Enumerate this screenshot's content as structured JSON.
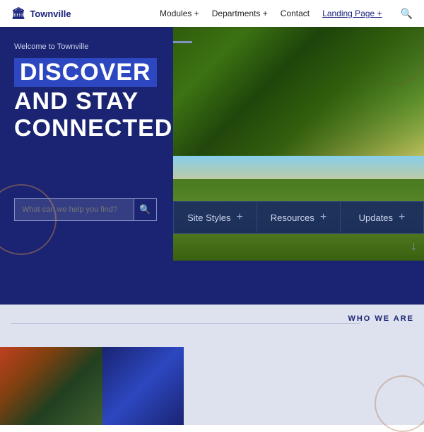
{
  "navbar": {
    "logo_text": "Townville",
    "links": [
      {
        "label": "Modules +",
        "id": "modules"
      },
      {
        "label": "Departments +",
        "id": "departments"
      },
      {
        "label": "Contact",
        "id": "contact"
      },
      {
        "label": "Landing Page +",
        "id": "landing",
        "underlined": true
      }
    ]
  },
  "hero": {
    "welcome": "Welcome to Townville",
    "discover": "DISCOVER",
    "and_stay": "AND STAY",
    "connected": "CONNECTED",
    "search_placeholder": "What can we help you find?",
    "tabs": [
      {
        "label": "Site Styles",
        "id": "site-styles"
      },
      {
        "label": "Resources",
        "id": "resources"
      },
      {
        "label": "Updates",
        "id": "updates"
      }
    ]
  },
  "who_section": {
    "label": "WHO WE ARE"
  }
}
